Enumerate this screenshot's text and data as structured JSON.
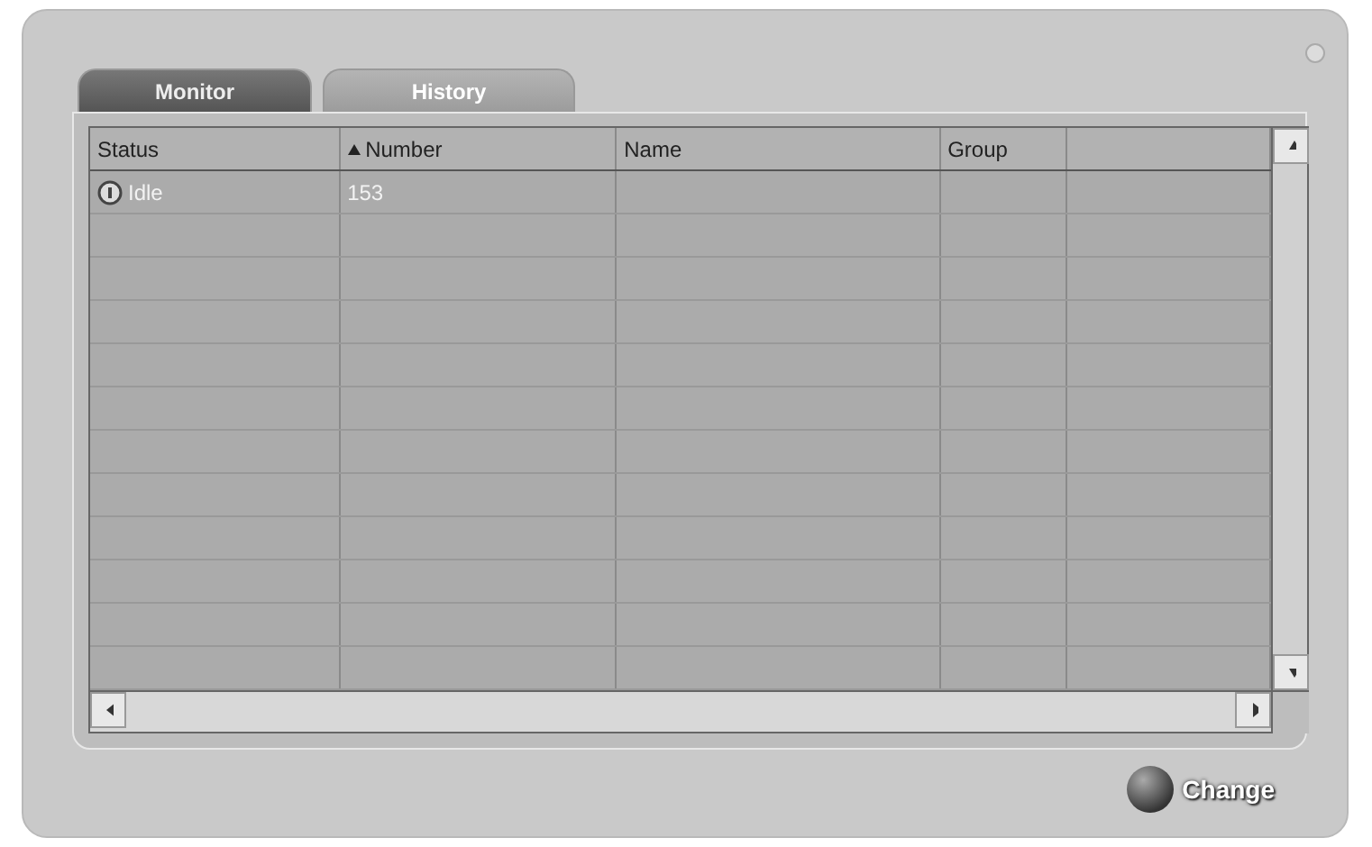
{
  "tabs": [
    {
      "label": "Monitor",
      "selected": true
    },
    {
      "label": "History",
      "selected": false
    }
  ],
  "table": {
    "columns": [
      {
        "label": "Status",
        "sorted": false
      },
      {
        "label": "Number",
        "sorted": true
      },
      {
        "label": "Name",
        "sorted": false
      },
      {
        "label": "Group",
        "sorted": false
      },
      {
        "sorted": false
      }
    ],
    "rows": [
      {
        "status": "Idle",
        "number": "153"
      }
    ]
  },
  "change_button": {
    "label": "Change"
  }
}
